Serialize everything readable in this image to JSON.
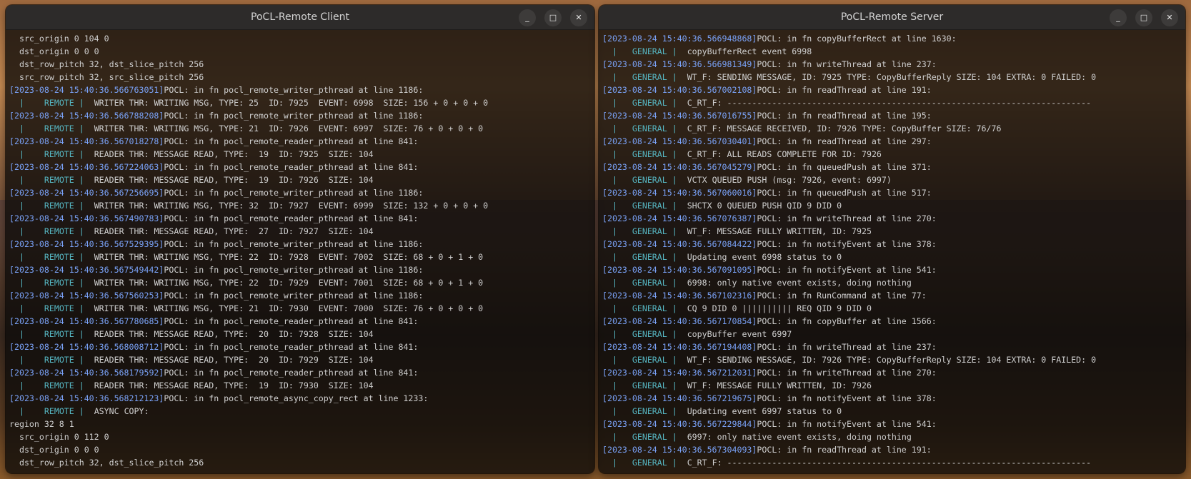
{
  "client": {
    "title": "PoCL-Remote Client",
    "lines": [
      "  src_origin 0 104 0",
      "  dst_origin 0 0 0",
      "  dst_row_pitch 32, dst_slice_pitch 256",
      "  src_row_pitch 32, src_slice_pitch 256",
      "[2023-08-24 15:40:36.566763051]POCL: in fn pocl_remote_writer_pthread at line 1186:",
      "  |    REMOTE |  WRITER THR: WRITING MSG, TYPE: 25  ID: 7925  EVENT: 6998  SIZE: 156 + 0 + 0 + 0",
      "[2023-08-24 15:40:36.566788208]POCL: in fn pocl_remote_writer_pthread at line 1186:",
      "  |    REMOTE |  WRITER THR: WRITING MSG, TYPE: 21  ID: 7926  EVENT: 6997  SIZE: 76 + 0 + 0 + 0",
      "[2023-08-24 15:40:36.567018278]POCL: in fn pocl_remote_reader_pthread at line 841:",
      "  |    REMOTE |  READER THR: MESSAGE READ, TYPE:  19  ID: 7925  SIZE: 104",
      "[2023-08-24 15:40:36.567224063]POCL: in fn pocl_remote_reader_pthread at line 841:",
      "  |    REMOTE |  READER THR: MESSAGE READ, TYPE:  19  ID: 7926  SIZE: 104",
      "[2023-08-24 15:40:36.567256695]POCL: in fn pocl_remote_writer_pthread at line 1186:",
      "  |    REMOTE |  WRITER THR: WRITING MSG, TYPE: 32  ID: 7927  EVENT: 6999  SIZE: 132 + 0 + 0 + 0",
      "[2023-08-24 15:40:36.567490783]POCL: in fn pocl_remote_reader_pthread at line 841:",
      "  |    REMOTE |  READER THR: MESSAGE READ, TYPE:  27  ID: 7927  SIZE: 104",
      "[2023-08-24 15:40:36.567529395]POCL: in fn pocl_remote_writer_pthread at line 1186:",
      "  |    REMOTE |  WRITER THR: WRITING MSG, TYPE: 22  ID: 7928  EVENT: 7002  SIZE: 68 + 0 + 1 + 0",
      "[2023-08-24 15:40:36.567549442]POCL: in fn pocl_remote_writer_pthread at line 1186:",
      "  |    REMOTE |  WRITER THR: WRITING MSG, TYPE: 22  ID: 7929  EVENT: 7001  SIZE: 68 + 0 + 1 + 0",
      "[2023-08-24 15:40:36.567560253]POCL: in fn pocl_remote_writer_pthread at line 1186:",
      "  |    REMOTE |  WRITER THR: WRITING MSG, TYPE: 21  ID: 7930  EVENT: 7000  SIZE: 76 + 0 + 0 + 0",
      "[2023-08-24 15:40:36.567780685]POCL: in fn pocl_remote_reader_pthread at line 841:",
      "  |    REMOTE |  READER THR: MESSAGE READ, TYPE:  20  ID: 7928  SIZE: 104",
      "[2023-08-24 15:40:36.568008712]POCL: in fn pocl_remote_reader_pthread at line 841:",
      "  |    REMOTE |  READER THR: MESSAGE READ, TYPE:  20  ID: 7929  SIZE: 104",
      "[2023-08-24 15:40:36.568179592]POCL: in fn pocl_remote_reader_pthread at line 841:",
      "  |    REMOTE |  READER THR: MESSAGE READ, TYPE:  19  ID: 7930  SIZE: 104",
      "[2023-08-24 15:40:36.568212123]POCL: in fn pocl_remote_async_copy_rect at line 1233:",
      "  |    REMOTE |  ASYNC COPY:",
      "region 32 8 1",
      "  src_origin 0 112 0",
      "  dst_origin 0 0 0",
      "  dst_row_pitch 32, dst_slice_pitch 256"
    ]
  },
  "server": {
    "title": "PoCL-Remote Server",
    "lines": [
      "[2023-08-24 15:40:36.566948868]POCL: in fn copyBufferRect at line 1630:",
      "  |   GENERAL |  copyBufferRect event 6998",
      "[2023-08-24 15:40:36.566981349]POCL: in fn writeThread at line 237:",
      "  |   GENERAL |  WT_F: SENDING MESSAGE, ID: 7925 TYPE: CopyBufferReply SIZE: 104 EXTRA: 0 FAILED: 0",
      "[2023-08-24 15:40:36.567002108]POCL: in fn readThread at line 191:",
      "  |   GENERAL |  C_RT_F: -------------------------------------------------------------------------",
      "[2023-08-24 15:40:36.567016755]POCL: in fn readThread at line 195:",
      "  |   GENERAL |  C_RT_F: MESSAGE RECEIVED, ID: 7926 TYPE: CopyBuffer SIZE: 76/76",
      "[2023-08-24 15:40:36.567030401]POCL: in fn readThread at line 297:",
      "  |   GENERAL |  C_RT_F: ALL READS COMPLETE FOR ID: 7926",
      "[2023-08-24 15:40:36.567045279]POCL: in fn queuedPush at line 371:",
      "  |   GENERAL |  VCTX QUEUED PUSH (msg: 7926, event: 6997)",
      "[2023-08-24 15:40:36.567060016]POCL: in fn queuedPush at line 517:",
      "  |   GENERAL |  SHCTX 0 QUEUED PUSH QID 9 DID 0",
      "[2023-08-24 15:40:36.567076387]POCL: in fn writeThread at line 270:",
      "  |   GENERAL |  WT_F: MESSAGE FULLY WRITTEN, ID: 7925",
      "[2023-08-24 15:40:36.567084422]POCL: in fn notifyEvent at line 378:",
      "  |   GENERAL |  Updating event 6998 status to 0",
      "[2023-08-24 15:40:36.567091095]POCL: in fn notifyEvent at line 541:",
      "  |   GENERAL |  6998: only native event exists, doing nothing",
      "[2023-08-24 15:40:36.567102316]POCL: in fn RunCommand at line 77:",
      "  |   GENERAL |  CQ 9 DID 0 |||||||||| REQ QID 9 DID 0",
      "[2023-08-24 15:40:36.567170854]POCL: in fn copyBuffer at line 1566:",
      "  |   GENERAL |  copyBuffer event 6997",
      "[2023-08-24 15:40:36.567194408]POCL: in fn writeThread at line 237:",
      "  |   GENERAL |  WT_F: SENDING MESSAGE, ID: 7926 TYPE: CopyBufferReply SIZE: 104 EXTRA: 0 FAILED: 0",
      "[2023-08-24 15:40:36.567212031]POCL: in fn writeThread at line 270:",
      "  |   GENERAL |  WT_F: MESSAGE FULLY WRITTEN, ID: 7926",
      "[2023-08-24 15:40:36.567219675]POCL: in fn notifyEvent at line 378:",
      "  |   GENERAL |  Updating event 6997 status to 0",
      "[2023-08-24 15:40:36.567229844]POCL: in fn notifyEvent at line 541:",
      "  |   GENERAL |  6997: only native event exists, doing nothing",
      "[2023-08-24 15:40:36.567304093]POCL: in fn readThread at line 191:",
      "  |   GENERAL |  C_RT_F: -------------------------------------------------------------------------"
    ]
  },
  "window_controls": {
    "minimize": "_",
    "maximize": "□",
    "close": "✕"
  },
  "colors": {
    "timestamp": "#7aa2f7",
    "tag": "#56b6c2",
    "text": "#d0d0d0"
  }
}
